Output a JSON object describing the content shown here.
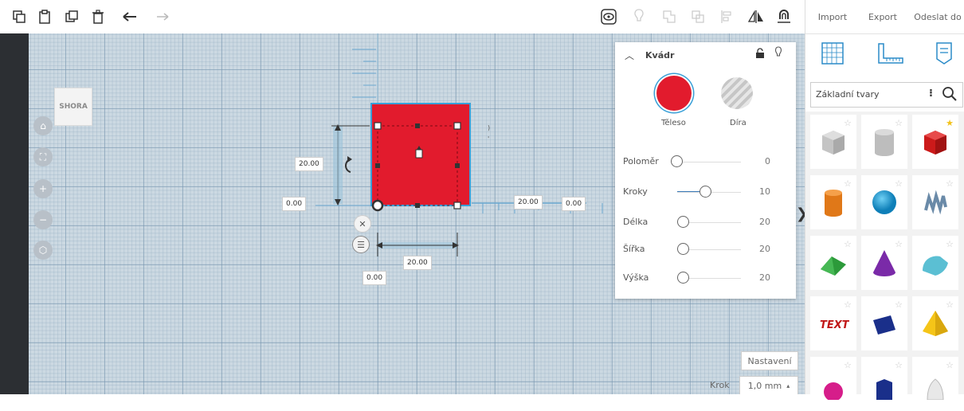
{
  "toolbar": {
    "icons": [
      "copy-icon",
      "paste-icon",
      "duplicate-icon",
      "trash-icon",
      "undo-icon",
      "redo-icon",
      "show-hide-icon",
      "light-icon",
      "group-icon",
      "ungroup-icon",
      "align-icon",
      "mirror-icon",
      "workplane-magnet-icon"
    ]
  },
  "topright": {
    "import": "Import",
    "export": "Export",
    "send": "Odeslat do"
  },
  "viewcube": {
    "label": "SHORA"
  },
  "dimensions": {
    "height_left": "20.00",
    "origin_x": "0.00",
    "length_right": "20.00",
    "right_offset": "0.00",
    "width_bottom": "20.00",
    "bottom_origin": "0.00"
  },
  "panel": {
    "title": "Kvádr",
    "solid_label": "Těleso",
    "hole_label": "Díra",
    "solid_color": "#e21b2d",
    "properties": [
      {
        "label": "Poloměr",
        "value": "0",
        "fraction": 0.0
      },
      {
        "label": "Kroky",
        "value": "10",
        "fraction": 0.45
      },
      {
        "label": "Délka",
        "value": "20",
        "fraction": 0.1
      },
      {
        "label": "Šířka",
        "value": "20",
        "fraction": 0.1
      },
      {
        "label": "Výška",
        "value": "20",
        "fraction": 0.1
      }
    ]
  },
  "library": {
    "category": "Základní tvary",
    "tabs": [
      "grid-icon",
      "ruler-icon",
      "note-icon"
    ]
  },
  "bottom": {
    "settings": "Nastavení",
    "step_label": "Krok",
    "step_value": "1,0 mm"
  },
  "colors": {
    "accent": "#e21b2d",
    "selection": "#3aa0d8",
    "grid_bg": "#ccd9e2"
  }
}
